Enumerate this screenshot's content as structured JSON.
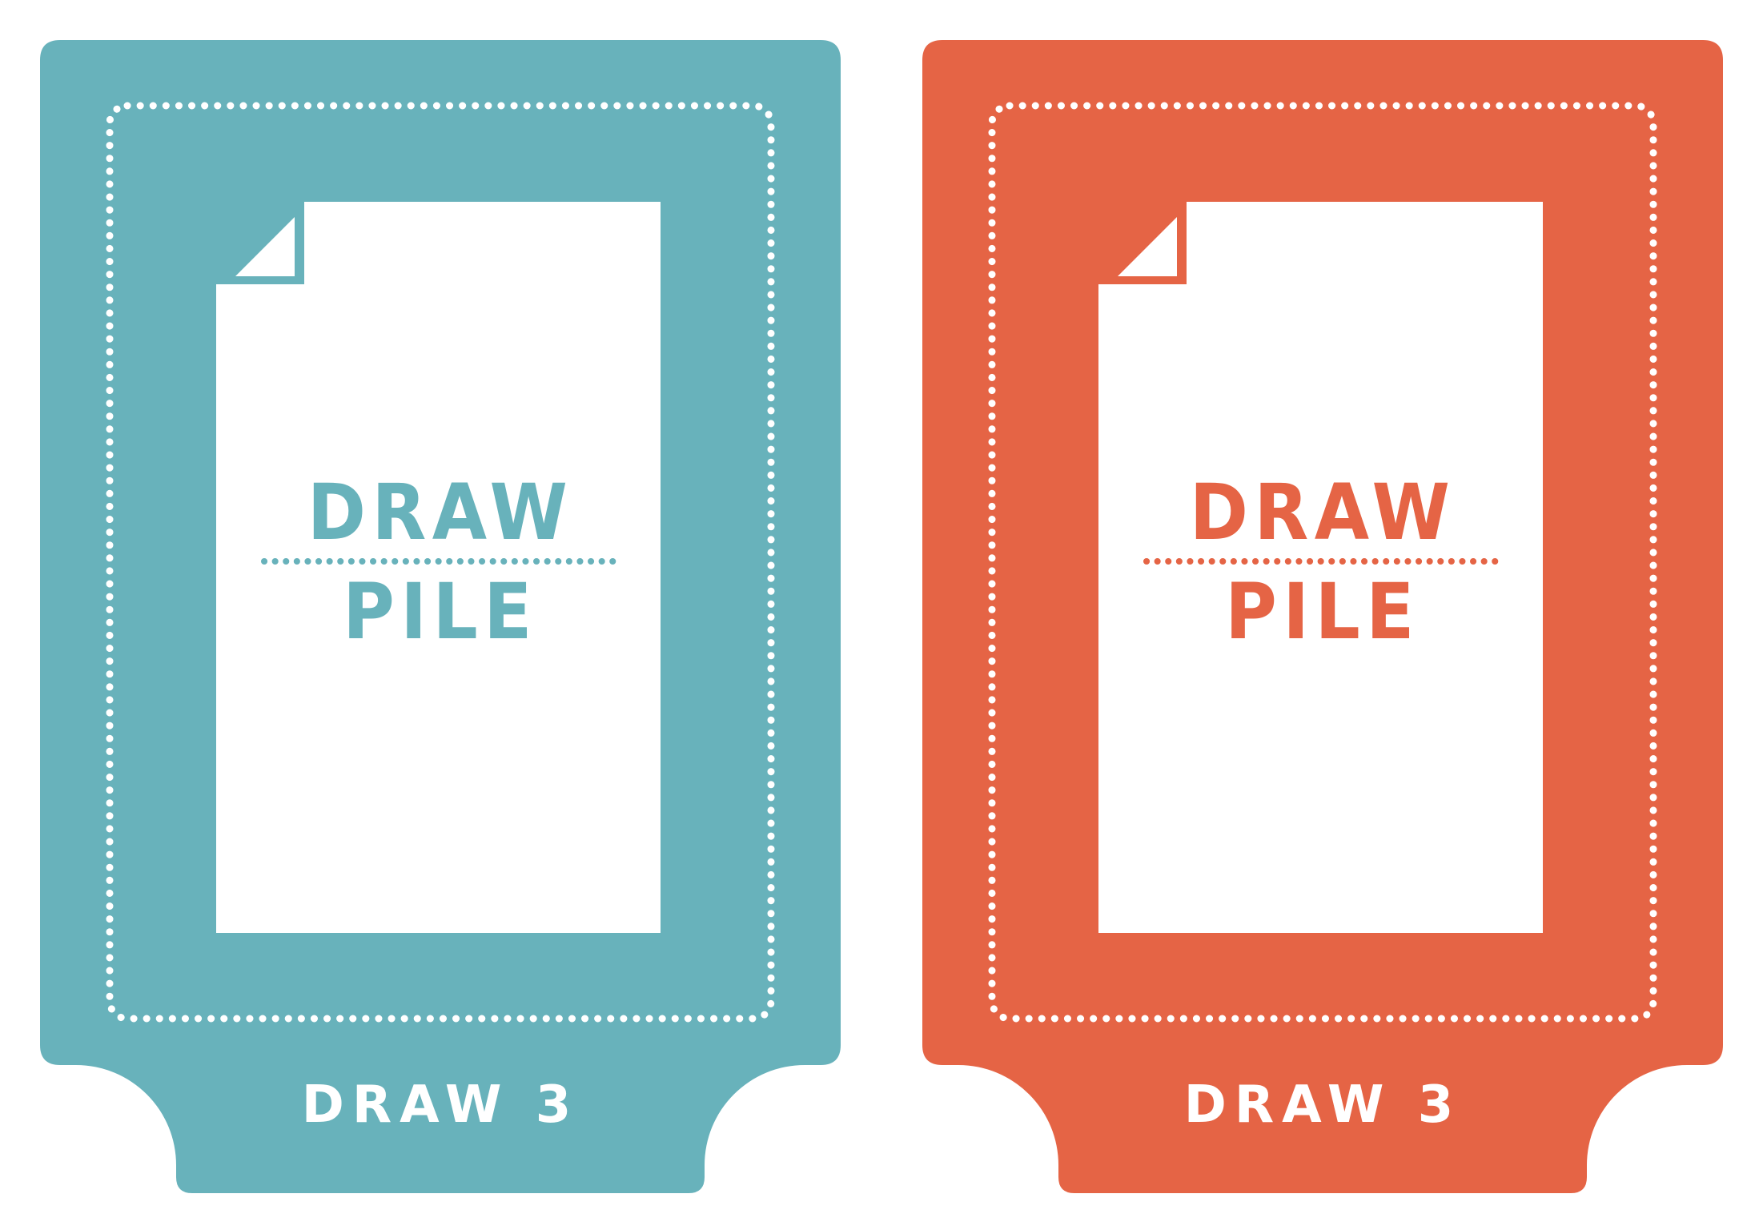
{
  "cards": [
    {
      "title_top": "DRAW",
      "title_bottom": "PILE",
      "footer_label": "DRAW 3",
      "color": "#68b2bb",
      "icon": "document-icon"
    },
    {
      "title_top": "DRAW",
      "title_bottom": "PILE",
      "footer_label": "DRAW 3",
      "color": "#e56445",
      "icon": "document-icon"
    }
  ],
  "colors": {
    "teal": "#68b2bb",
    "orange": "#e56445",
    "paper": "#ffffff"
  }
}
